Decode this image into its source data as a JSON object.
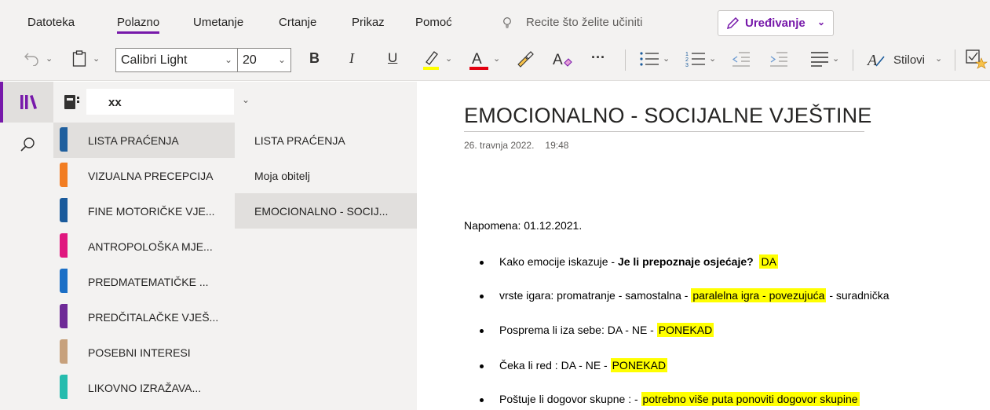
{
  "menu_tabs": [
    "Datoteka",
    "Polazno",
    "Umetanje",
    "Crtanje",
    "Prikaz",
    "Pomoć"
  ],
  "active_tab": "Polazno",
  "tell_me": "Recite što želite učiniti",
  "edit_mode": {
    "label": "Uređivanje"
  },
  "toolbar": {
    "font_name": "Calibri Light",
    "font_size": "20",
    "bold": "B",
    "italic": "I",
    "underline": "U",
    "more": "···",
    "styles_label": "Stilovi",
    "highlight_color": "#ffff00",
    "font_color": "#e3000f"
  },
  "notebook": {
    "name": "xx"
  },
  "sections": [
    {
      "label": "LISTA PRAĆENJA",
      "color": "#1f5f9e"
    },
    {
      "label": "VIZUALNA PRECEPCIJA",
      "color": "#f27d22"
    },
    {
      "label": "FINE MOTORIČKE VJE...",
      "color": "#1a5b9c"
    },
    {
      "label": "ANTROPOLOŠKA MJE...",
      "color": "#e0177f"
    },
    {
      "label": "PREDMATEMATIČKE ...",
      "color": "#1b6fc6"
    },
    {
      "label": "PREDČITALAČKE VJEŠ...",
      "color": "#6e2a97"
    },
    {
      "label": "POSEBNI INTERESI",
      "color": "#c7a17c"
    },
    {
      "label": "LIKOVNO IZRAŽAVA...",
      "color": "#26bcae"
    }
  ],
  "selected_section": 0,
  "pages": [
    "LISTA PRAĆENJA",
    "Moja obitelj",
    "EMOCIONALNO - SOCIJ..."
  ],
  "selected_page": 2,
  "page": {
    "title": "EMOCIONALNO - SOCIJALNE VJEŠTINE",
    "date": "26. travnja 2022.",
    "time": "19:48",
    "note": "Napomena: 01.12.2021.",
    "bullets": [
      {
        "a": "Kako emocije iskazuje - ",
        "b": "Je li prepoznaje osjećaje?",
        "h": "DA",
        "c": ""
      },
      {
        "a": " vrste igara: promatranje  - samostalna - ",
        "b": "",
        "h": "paralelna igra  - povezujuća",
        "c": " - suradnička"
      },
      {
        "a": "Posprema li iza sebe: DA  -  NE  - ",
        "b": "",
        "h": "PONEKAD",
        "c": ""
      },
      {
        "a": "Čeka li red : DA   -  NE - ",
        "b": "",
        "h": "PONEKAD",
        "c": ""
      },
      {
        "a": "Poštuje li dogovor skupne : - ",
        "b": "",
        "h": "potrebno više puta ponoviti dogovor skupine",
        "c": ""
      }
    ]
  }
}
